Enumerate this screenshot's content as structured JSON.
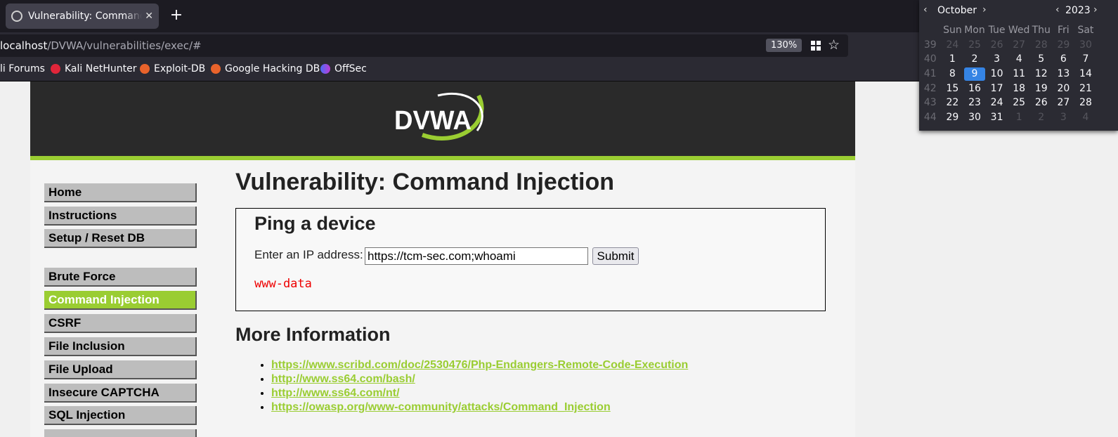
{
  "browser": {
    "tab_title": "Vulnerability: Command Injection :: Damn Vulnerable Web Application",
    "tab_close": "✕",
    "new_tab": "+",
    "url_host": "localhost",
    "url_path": "/DVWA/vulnerabilities/exec/#",
    "zoom": "130%",
    "bookmarks": [
      {
        "label": "li Forums"
      },
      {
        "label": "Kali NetHunter"
      },
      {
        "label": "Exploit-DB"
      },
      {
        "label": "Google Hacking DB"
      },
      {
        "label": "OffSec"
      }
    ]
  },
  "dvwa": {
    "logo_text": "DVWA",
    "menu": [
      {
        "label": "Home"
      },
      {
        "label": "Instructions"
      },
      {
        "label": "Setup / Reset DB"
      },
      {
        "label": "Brute Force"
      },
      {
        "label": "Command Injection"
      },
      {
        "label": "CSRF"
      },
      {
        "label": "File Inclusion"
      },
      {
        "label": "File Upload"
      },
      {
        "label": "Insecure CAPTCHA"
      },
      {
        "label": "SQL Injection"
      }
    ],
    "page_title": "Vulnerability: Command Injection",
    "form": {
      "heading": "Ping a device",
      "label": "Enter an IP address:",
      "ip_value": "https://tcm-sec.com;whoami",
      "submit": "Submit",
      "output": "www-data"
    },
    "more_heading": "More Information",
    "links": [
      "https://www.scribd.com/doc/2530476/Php-Endangers-Remote-Code-Execution",
      "http://www.ss64.com/bash/",
      "http://www.ss64.com/nt/",
      "https://owasp.org/www-community/attacks/Command_Injection"
    ]
  },
  "calendar": {
    "month": "October",
    "year": "2023",
    "prev": "‹",
    "next": "›",
    "weekdays": [
      "Sun",
      "Mon",
      "Tue",
      "Wed",
      "Thu",
      "Fri",
      "Sat"
    ],
    "weeks": [
      {
        "wk": "39",
        "days": [
          "24",
          "25",
          "26",
          "27",
          "28",
          "29",
          "30"
        ]
      },
      {
        "wk": "40",
        "days": [
          "1",
          "2",
          "3",
          "4",
          "5",
          "6",
          "7"
        ]
      },
      {
        "wk": "41",
        "days": [
          "8",
          "9",
          "10",
          "11",
          "12",
          "13",
          "14"
        ]
      },
      {
        "wk": "42",
        "days": [
          "15",
          "16",
          "17",
          "18",
          "19",
          "20",
          "21"
        ]
      },
      {
        "wk": "43",
        "days": [
          "22",
          "23",
          "24",
          "25",
          "26",
          "27",
          "28"
        ]
      },
      {
        "wk": "44",
        "days": [
          "29",
          "30",
          "31",
          "1",
          "2",
          "3",
          "4"
        ]
      }
    ],
    "selected_day": "9"
  },
  "colors": {
    "dvwa_green": "#9acd32",
    "header_dark": "#2a2a2a",
    "output_red": "#e00000",
    "calendar_highlight": "#3584e4"
  }
}
